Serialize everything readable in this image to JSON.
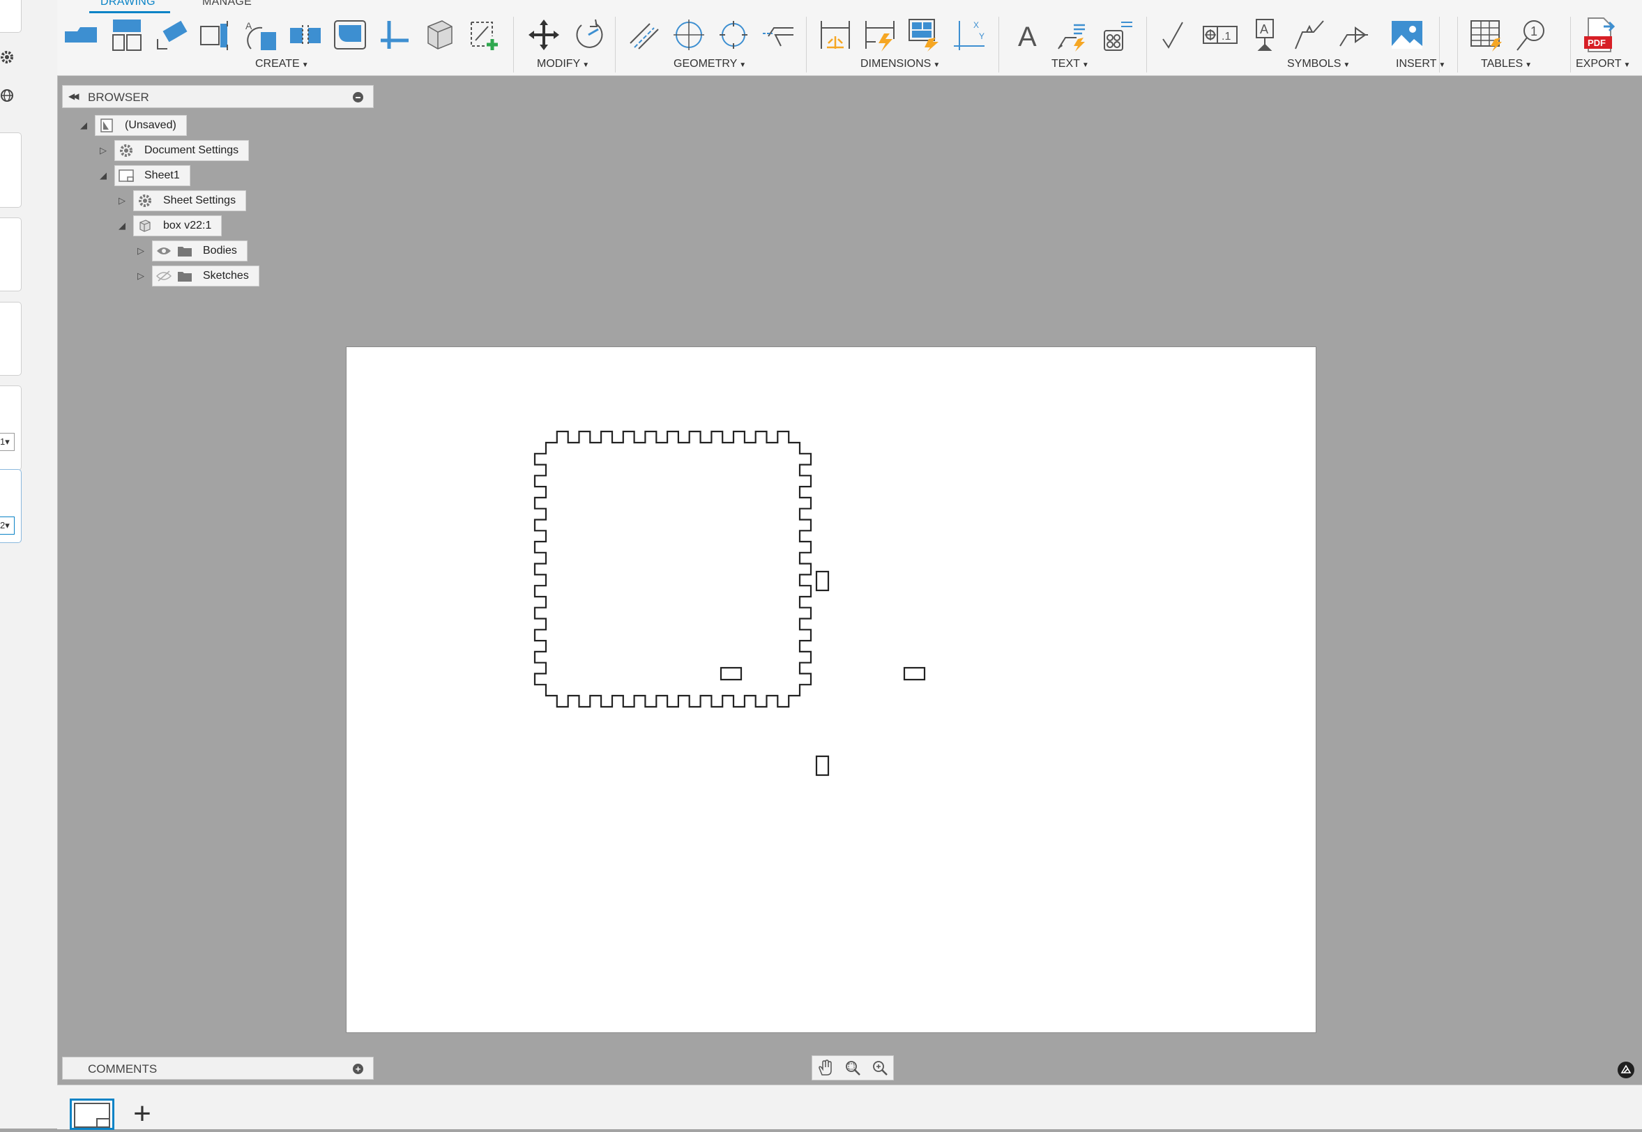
{
  "toolbar": {
    "tabs": [
      {
        "label": "DRAWING",
        "active": true
      },
      {
        "label": "MANAGE",
        "active": false
      }
    ],
    "groups": [
      {
        "label": "CREATE"
      },
      {
        "label": "MODIFY"
      },
      {
        "label": "GEOMETRY"
      },
      {
        "label": "DIMENSIONS"
      },
      {
        "label": "TEXT"
      },
      {
        "label": "SYMBOLS"
      },
      {
        "label": "INSERT"
      },
      {
        "label": "TABLES"
      },
      {
        "label": "EXPORT"
      }
    ],
    "accent_color": "#0a83c6",
    "icon_blue": "#3d8fd1",
    "icon_orange": "#f5a623",
    "icon_green": "#2fa84f",
    "pdf_red": "#d71f26"
  },
  "left_strip": {
    "drop1_value": "1",
    "drop2_value": "2"
  },
  "browser": {
    "title": "BROWSER",
    "tree": [
      {
        "label": "(Unsaved)",
        "icon": "drawing-document-icon",
        "expanded": true
      },
      {
        "label": "Document Settings",
        "icon": "gear-icon",
        "expanded": false
      },
      {
        "label": "Sheet1",
        "icon": "sheet-icon",
        "expanded": true
      },
      {
        "label": "Sheet Settings",
        "icon": "gear-icon",
        "expanded": false
      },
      {
        "label": "box v22:1",
        "icon": "component-icon",
        "expanded": true
      },
      {
        "label": "Bodies",
        "icon": "folder-icon",
        "visible": true,
        "expanded": false
      },
      {
        "label": "Sketches",
        "icon": "folder-icon",
        "visible": false,
        "expanded": false
      }
    ]
  },
  "comments": {
    "title": "COMMENTS"
  },
  "canvas": {
    "background": "#a3a3a3",
    "sheet_color": "#ffffff",
    "drawing": "finger-joint box panel with four slots"
  },
  "nav": {
    "buttons": [
      "pan-icon",
      "zoom-window-icon",
      "zoom-icon"
    ]
  }
}
